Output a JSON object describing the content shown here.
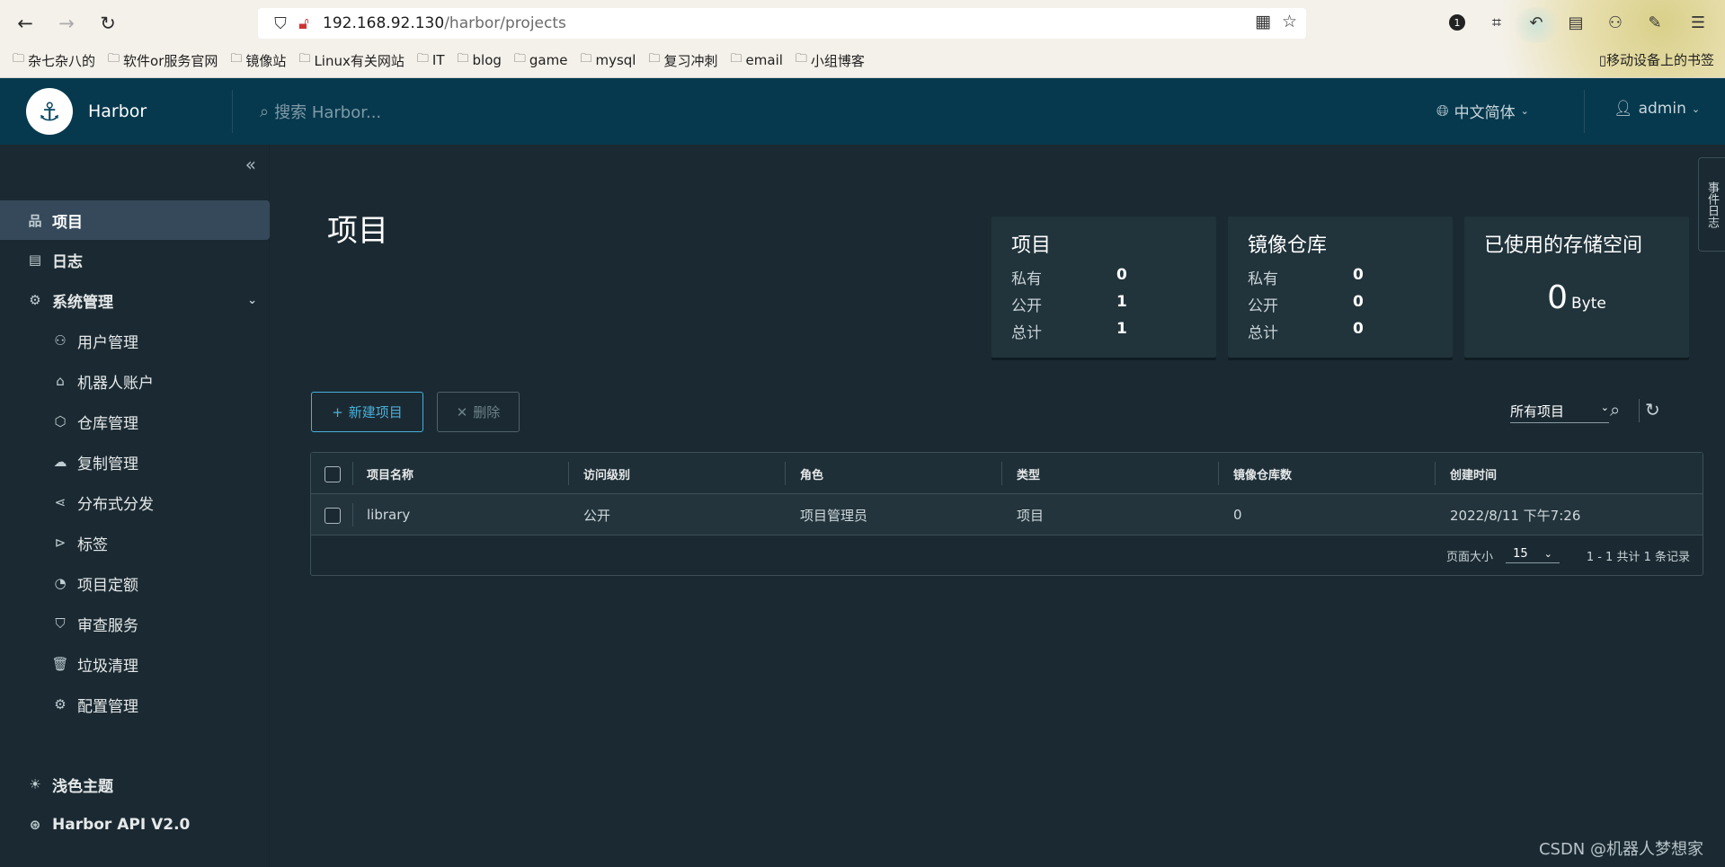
{
  "browser": {
    "url_host": "192.168.92.130",
    "url_path": "/harbor/projects",
    "bookmarks": [
      "杂七杂八的",
      "软件or服务官网",
      "镜像站",
      "Linux有关网站",
      "IT",
      "blog",
      "game",
      "mysql",
      "复习冲刺",
      "email",
      "小组博客"
    ],
    "mobile_bookmarks": "移动设备上的书签",
    "ext_badge": "1"
  },
  "header": {
    "brand": "Harbor",
    "search_placeholder": "搜索 Harbor...",
    "language": "中文简体",
    "user": "admin"
  },
  "sidebar": {
    "items": [
      {
        "label": "项目",
        "icon": "project-icon"
      },
      {
        "label": "日志",
        "icon": "logs-icon"
      },
      {
        "label": "系统管理",
        "icon": "admin-icon"
      },
      {
        "label": "用户管理",
        "icon": "users-icon"
      },
      {
        "label": "机器人账户",
        "icon": "robot-icon"
      },
      {
        "label": "仓库管理",
        "icon": "registry-icon"
      },
      {
        "label": "复制管理",
        "icon": "replication-icon"
      },
      {
        "label": "分布式分发",
        "icon": "distribution-icon"
      },
      {
        "label": "标签",
        "icon": "tag-icon"
      },
      {
        "label": "项目定额",
        "icon": "quota-icon"
      },
      {
        "label": "审查服务",
        "icon": "shield-icon"
      },
      {
        "label": "垃圾清理",
        "icon": "trash-icon"
      },
      {
        "label": "配置管理",
        "icon": "gear-icon"
      }
    ],
    "theme": "浅色主题",
    "api": "Harbor API V2.0"
  },
  "main": {
    "title": "项目",
    "cards": {
      "projects": {
        "title": "项目",
        "rows": [
          {
            "k": "私有",
            "v": "0"
          },
          {
            "k": "公开",
            "v": "1"
          },
          {
            "k": "总计",
            "v": "1"
          }
        ]
      },
      "repos": {
        "title": "镜像仓库",
        "rows": [
          {
            "k": "私有",
            "v": "0"
          },
          {
            "k": "公开",
            "v": "0"
          },
          {
            "k": "总计",
            "v": "0"
          }
        ]
      },
      "storage": {
        "title": "已使用的存储空间",
        "value": "0",
        "unit": "Byte"
      }
    },
    "new_project": "新建项目",
    "delete": "删除",
    "filter": "所有项目",
    "columns": [
      "项目名称",
      "访问级别",
      "角色",
      "类型",
      "镜像仓库数",
      "创建时间"
    ],
    "rows": [
      {
        "name": "library",
        "access": "公开",
        "role": "项目管理员",
        "type": "项目",
        "repo_count": "0",
        "created": "2022/8/11 下午7:26"
      }
    ],
    "page_size_label": "页面大小",
    "page_size": "15",
    "pagination": "1 - 1 共计 1 条记录"
  },
  "side_tab": "事件日志",
  "watermark": "CSDN @机器人梦想家"
}
